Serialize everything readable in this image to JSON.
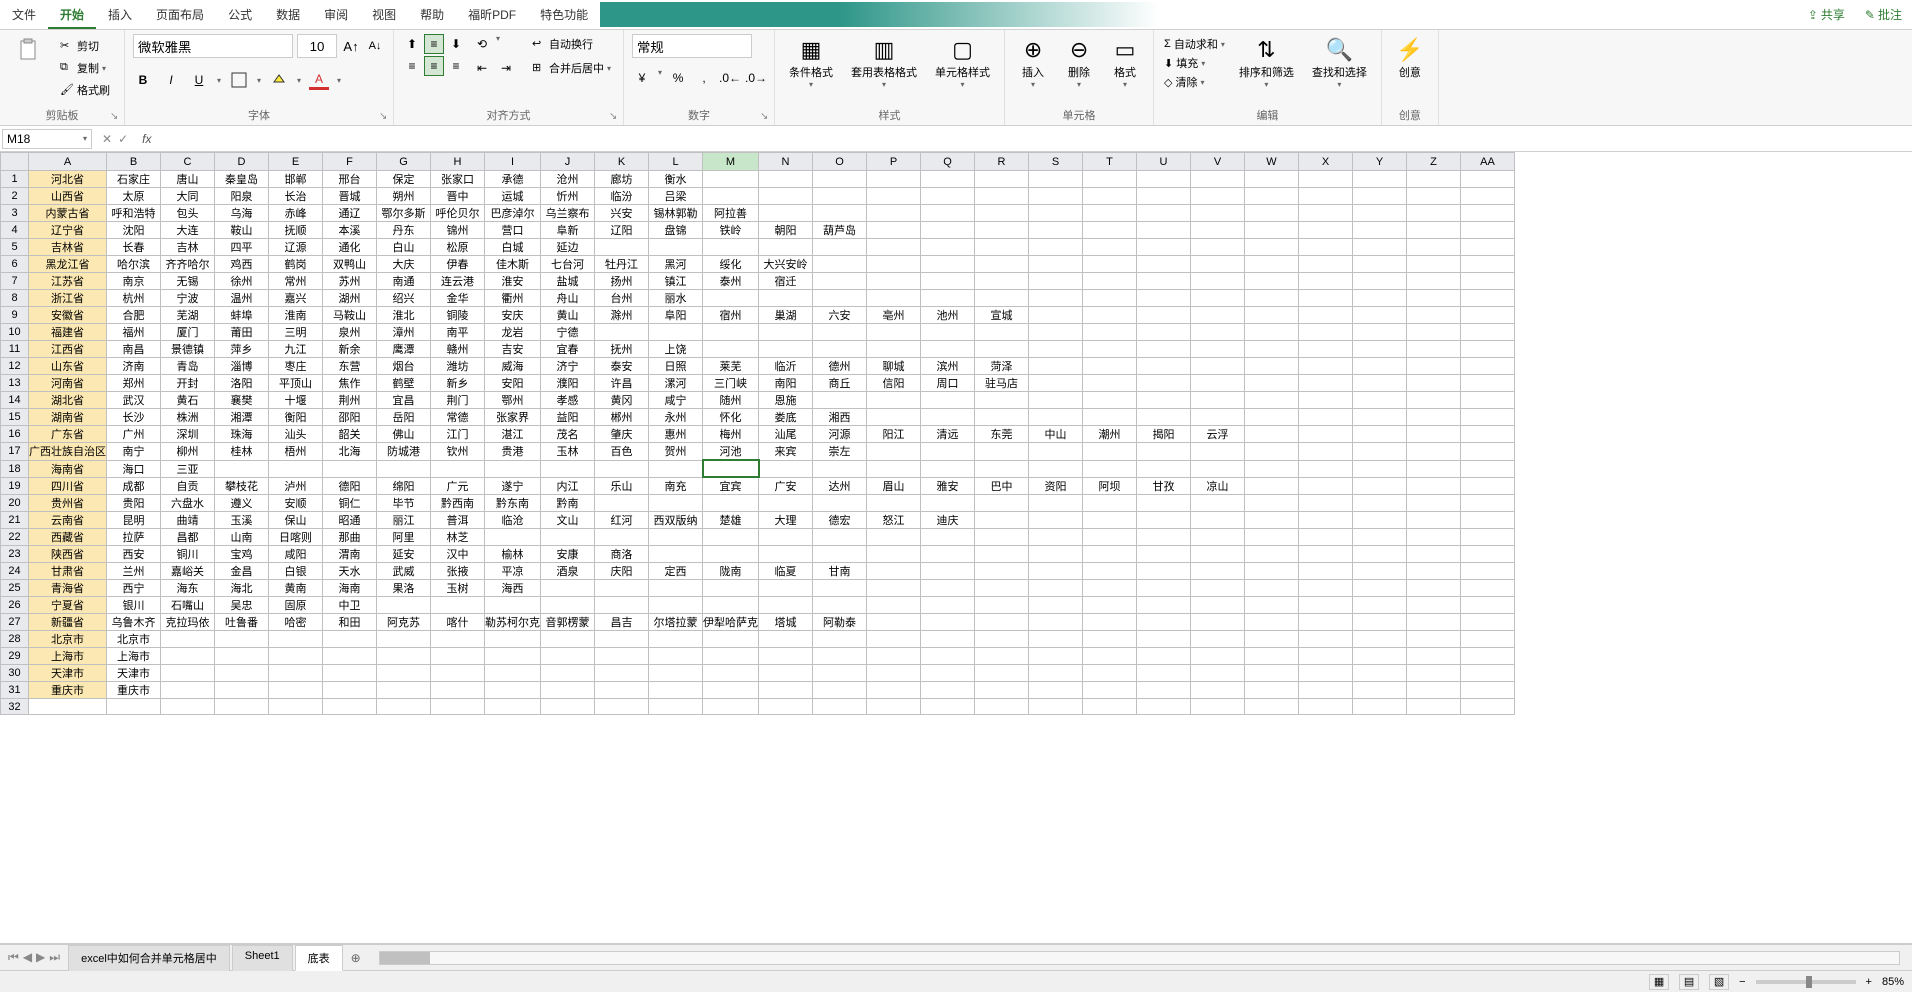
{
  "menu": {
    "items": [
      "文件",
      "开始",
      "插入",
      "页面布局",
      "公式",
      "数据",
      "审阅",
      "视图",
      "帮助",
      "福昕PDF",
      "特色功能"
    ],
    "activeIndex": 1,
    "share": "共享",
    "annotate": "批注"
  },
  "ribbon": {
    "clipboard": {
      "label": "剪贴板",
      "cut": "剪切",
      "copy": "复制",
      "format_painter": "格式刷",
      "paste": "粘贴"
    },
    "font": {
      "label": "字体",
      "name": "微软雅黑",
      "size": "10",
      "bold": "B",
      "italic": "I",
      "underline": "U"
    },
    "align": {
      "label": "对齐方式",
      "wrap": "自动换行",
      "merge": "合并后居中"
    },
    "number": {
      "label": "数字",
      "format": "常规"
    },
    "styles": {
      "label": "样式",
      "conditional": "条件格式",
      "as_table": "套用表格格式",
      "cell_styles": "单元格样式"
    },
    "cells": {
      "label": "单元格",
      "insert": "插入",
      "delete": "删除",
      "format": "格式"
    },
    "edit": {
      "label": "编辑",
      "autosum": "自动求和",
      "fill": "填充",
      "clear": "清除",
      "sort": "排序和筛选",
      "find": "查找和选择"
    },
    "creative": {
      "label": "创意",
      "btn": "创意"
    }
  },
  "formula_bar": {
    "cell": "M18",
    "fx": "fx",
    "value": ""
  },
  "columns": [
    "A",
    "B",
    "C",
    "D",
    "E",
    "F",
    "G",
    "H",
    "I",
    "J",
    "K",
    "L",
    "M",
    "N",
    "O",
    "P",
    "Q",
    "R",
    "S",
    "T",
    "U",
    "V",
    "W",
    "X",
    "Y",
    "Z",
    "AA"
  ],
  "selectedColIndex": 12,
  "selectedRowIndex": 17,
  "rows": [
    [
      "河北省",
      "石家庄",
      "唐山",
      "秦皇岛",
      "邯郸",
      "邢台",
      "保定",
      "张家口",
      "承德",
      "沧州",
      "廊坊",
      "衡水",
      "",
      "",
      "",
      "",
      "",
      "",
      "",
      "",
      "",
      "",
      "",
      "",
      "",
      "",
      ""
    ],
    [
      "山西省",
      "太原",
      "大同",
      "阳泉",
      "长治",
      "晋城",
      "朔州",
      "晋中",
      "运城",
      "忻州",
      "临汾",
      "吕梁",
      "",
      "",
      "",
      "",
      "",
      "",
      "",
      "",
      "",
      "",
      "",
      "",
      "",
      "",
      ""
    ],
    [
      "内蒙古省",
      "呼和浩特",
      "包头",
      "乌海",
      "赤峰",
      "通辽",
      "鄂尔多斯",
      "呼伦贝尔",
      "巴彦淖尔",
      "乌兰察布",
      "兴安",
      "锡林郭勒",
      "阿拉善",
      "",
      "",
      "",
      "",
      "",
      "",
      "",
      "",
      "",
      "",
      "",
      "",
      "",
      ""
    ],
    [
      "辽宁省",
      "沈阳",
      "大连",
      "鞍山",
      "抚顺",
      "本溪",
      "丹东",
      "锦州",
      "营口",
      "阜新",
      "辽阳",
      "盘锦",
      "铁岭",
      "朝阳",
      "葫芦岛",
      "",
      "",
      "",
      "",
      "",
      "",
      "",
      "",
      "",
      "",
      "",
      ""
    ],
    [
      "吉林省",
      "长春",
      "吉林",
      "四平",
      "辽源",
      "通化",
      "白山",
      "松原",
      "白城",
      "延边",
      "",
      "",
      "",
      "",
      "",
      "",
      "",
      "",
      "",
      "",
      "",
      "",
      "",
      "",
      "",
      "",
      ""
    ],
    [
      "黑龙江省",
      "哈尔滨",
      "齐齐哈尔",
      "鸡西",
      "鹤岗",
      "双鸭山",
      "大庆",
      "伊春",
      "佳木斯",
      "七台河",
      "牡丹江",
      "黑河",
      "绥化",
      "大兴安岭",
      "",
      "",
      "",
      "",
      "",
      "",
      "",
      "",
      "",
      "",
      "",
      "",
      ""
    ],
    [
      "江苏省",
      "南京",
      "无锡",
      "徐州",
      "常州",
      "苏州",
      "南通",
      "连云港",
      "淮安",
      "盐城",
      "扬州",
      "镇江",
      "泰州",
      "宿迁",
      "",
      "",
      "",
      "",
      "",
      "",
      "",
      "",
      "",
      "",
      "",
      "",
      ""
    ],
    [
      "浙江省",
      "杭州",
      "宁波",
      "温州",
      "嘉兴",
      "湖州",
      "绍兴",
      "金华",
      "衢州",
      "舟山",
      "台州",
      "丽水",
      "",
      "",
      "",
      "",
      "",
      "",
      "",
      "",
      "",
      "",
      "",
      "",
      "",
      "",
      ""
    ],
    [
      "安徽省",
      "合肥",
      "芜湖",
      "蚌埠",
      "淮南",
      "马鞍山",
      "淮北",
      "铜陵",
      "安庆",
      "黄山",
      "滁州",
      "阜阳",
      "宿州",
      "巢湖",
      "六安",
      "亳州",
      "池州",
      "宣城",
      "",
      "",
      "",
      "",
      "",
      "",
      "",
      "",
      ""
    ],
    [
      "福建省",
      "福州",
      "厦门",
      "莆田",
      "三明",
      "泉州",
      "漳州",
      "南平",
      "龙岩",
      "宁德",
      "",
      "",
      "",
      "",
      "",
      "",
      "",
      "",
      "",
      "",
      "",
      "",
      "",
      "",
      "",
      "",
      ""
    ],
    [
      "江西省",
      "南昌",
      "景德镇",
      "萍乡",
      "九江",
      "新余",
      "鹰潭",
      "赣州",
      "吉安",
      "宜春",
      "抚州",
      "上饶",
      "",
      "",
      "",
      "",
      "",
      "",
      "",
      "",
      "",
      "",
      "",
      "",
      "",
      "",
      ""
    ],
    [
      "山东省",
      "济南",
      "青岛",
      "淄博",
      "枣庄",
      "东营",
      "烟台",
      "潍坊",
      "威海",
      "济宁",
      "泰安",
      "日照",
      "莱芜",
      "临沂",
      "德州",
      "聊城",
      "滨州",
      "菏泽",
      "",
      "",
      "",
      "",
      "",
      "",
      "",
      "",
      ""
    ],
    [
      "河南省",
      "郑州",
      "开封",
      "洛阳",
      "平顶山",
      "焦作",
      "鹤壁",
      "新乡",
      "安阳",
      "濮阳",
      "许昌",
      "漯河",
      "三门峡",
      "南阳",
      "商丘",
      "信阳",
      "周口",
      "驻马店",
      "",
      "",
      "",
      "",
      "",
      "",
      "",
      "",
      ""
    ],
    [
      "湖北省",
      "武汉",
      "黄石",
      "襄樊",
      "十堰",
      "荆州",
      "宜昌",
      "荆门",
      "鄂州",
      "孝感",
      "黄冈",
      "咸宁",
      "随州",
      "恩施",
      "",
      "",
      "",
      "",
      "",
      "",
      "",
      "",
      "",
      "",
      "",
      "",
      ""
    ],
    [
      "湖南省",
      "长沙",
      "株洲",
      "湘潭",
      "衡阳",
      "邵阳",
      "岳阳",
      "常德",
      "张家界",
      "益阳",
      "郴州",
      "永州",
      "怀化",
      "娄底",
      "湘西",
      "",
      "",
      "",
      "",
      "",
      "",
      "",
      "",
      "",
      "",
      "",
      ""
    ],
    [
      "广东省",
      "广州",
      "深圳",
      "珠海",
      "汕头",
      "韶关",
      "佛山",
      "江门",
      "湛江",
      "茂名",
      "肇庆",
      "惠州",
      "梅州",
      "汕尾",
      "河源",
      "阳江",
      "清远",
      "东莞",
      "中山",
      "潮州",
      "揭阳",
      "云浮",
      "",
      "",
      "",
      "",
      ""
    ],
    [
      "广西壮族自治区",
      "南宁",
      "柳州",
      "桂林",
      "梧州",
      "北海",
      "防城港",
      "钦州",
      "贵港",
      "玉林",
      "百色",
      "贺州",
      "河池",
      "来宾",
      "崇左",
      "",
      "",
      "",
      "",
      "",
      "",
      "",
      "",
      "",
      "",
      "",
      ""
    ],
    [
      "海南省",
      "海口",
      "三亚",
      "",
      "",
      "",
      "",
      "",
      "",
      "",
      "",
      "",
      "",
      "",
      "",
      "",
      "",
      "",
      "",
      "",
      "",
      "",
      "",
      "",
      "",
      "",
      ""
    ],
    [
      "四川省",
      "成都",
      "自贡",
      "攀枝花",
      "泸州",
      "德阳",
      "绵阳",
      "广元",
      "遂宁",
      "内江",
      "乐山",
      "南充",
      "宜宾",
      "广安",
      "达州",
      "眉山",
      "雅安",
      "巴中",
      "资阳",
      "阿坝",
      "甘孜",
      "凉山",
      "",
      "",
      "",
      "",
      ""
    ],
    [
      "贵州省",
      "贵阳",
      "六盘水",
      "遵义",
      "安顺",
      "铜仁",
      "毕节",
      "黔西南",
      "黔东南",
      "黔南",
      "",
      "",
      "",
      "",
      "",
      "",
      "",
      "",
      "",
      "",
      "",
      "",
      "",
      "",
      "",
      "",
      ""
    ],
    [
      "云南省",
      "昆明",
      "曲靖",
      "玉溪",
      "保山",
      "昭通",
      "丽江",
      "普洱",
      "临沧",
      "文山",
      "红河",
      "西双版纳",
      "楚雄",
      "大理",
      "德宏",
      "怒江",
      "迪庆",
      "",
      "",
      "",
      "",
      "",
      "",
      "",
      "",
      "",
      ""
    ],
    [
      "西藏省",
      "拉萨",
      "昌都",
      "山南",
      "日喀则",
      "那曲",
      "阿里",
      "林芝",
      "",
      "",
      "",
      "",
      "",
      "",
      "",
      "",
      "",
      "",
      "",
      "",
      "",
      "",
      "",
      "",
      "",
      "",
      ""
    ],
    [
      "陕西省",
      "西安",
      "铜川",
      "宝鸡",
      "咸阳",
      "渭南",
      "延安",
      "汉中",
      "榆林",
      "安康",
      "商洛",
      "",
      "",
      "",
      "",
      "",
      "",
      "",
      "",
      "",
      "",
      "",
      "",
      "",
      "",
      "",
      ""
    ],
    [
      "甘肃省",
      "兰州",
      "嘉峪关",
      "金昌",
      "白银",
      "天水",
      "武威",
      "张掖",
      "平凉",
      "酒泉",
      "庆阳",
      "定西",
      "陇南",
      "临夏",
      "甘南",
      "",
      "",
      "",
      "",
      "",
      "",
      "",
      "",
      "",
      "",
      "",
      ""
    ],
    [
      "青海省",
      "西宁",
      "海东",
      "海北",
      "黄南",
      "海南",
      "果洛",
      "玉树",
      "海西",
      "",
      "",
      "",
      "",
      "",
      "",
      "",
      "",
      "",
      "",
      "",
      "",
      "",
      "",
      "",
      "",
      "",
      ""
    ],
    [
      "宁夏省",
      "银川",
      "石嘴山",
      "吴忠",
      "固原",
      "中卫",
      "",
      "",
      "",
      "",
      "",
      "",
      "",
      "",
      "",
      "",
      "",
      "",
      "",
      "",
      "",
      "",
      "",
      "",
      "",
      "",
      ""
    ],
    [
      "新疆省",
      "乌鲁木齐",
      "克拉玛依",
      "吐鲁番",
      "哈密",
      "和田",
      "阿克苏",
      "喀什",
      "勒苏柯尔克",
      "音郭楞蒙",
      "昌吉",
      "尔塔拉蒙",
      "伊犁哈萨克",
      "塔城",
      "阿勒泰",
      "",
      "",
      "",
      "",
      "",
      "",
      "",
      "",
      "",
      "",
      "",
      ""
    ],
    [
      "北京市",
      "北京市",
      "",
      "",
      "",
      "",
      "",
      "",
      "",
      "",
      "",
      "",
      "",
      "",
      "",
      "",
      "",
      "",
      "",
      "",
      "",
      "",
      "",
      "",
      "",
      "",
      ""
    ],
    [
      "上海市",
      "上海市",
      "",
      "",
      "",
      "",
      "",
      "",
      "",
      "",
      "",
      "",
      "",
      "",
      "",
      "",
      "",
      "",
      "",
      "",
      "",
      "",
      "",
      "",
      "",
      "",
      ""
    ],
    [
      "天津市",
      "天津市",
      "",
      "",
      "",
      "",
      "",
      "",
      "",
      "",
      "",
      "",
      "",
      "",
      "",
      "",
      "",
      "",
      "",
      "",
      "",
      "",
      "",
      "",
      "",
      "",
      ""
    ],
    [
      "重庆市",
      "重庆市",
      "",
      "",
      "",
      "",
      "",
      "",
      "",
      "",
      "",
      "",
      "",
      "",
      "",
      "",
      "",
      "",
      "",
      "",
      "",
      "",
      "",
      "",
      "",
      "",
      ""
    ],
    [
      "",
      "",
      "",
      "",
      "",
      "",
      "",
      "",
      "",
      "",
      "",
      "",
      "",
      "",
      "",
      "",
      "",
      "",
      "",
      "",
      "",
      "",
      "",
      "",
      "",
      "",
      ""
    ]
  ],
  "sheets": {
    "tabs": [
      "excel中如何合并单元格居中",
      "Sheet1",
      "底表"
    ],
    "activeIndex": 2
  },
  "status": {
    "zoom": "85%"
  }
}
